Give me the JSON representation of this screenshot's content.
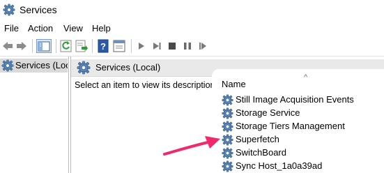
{
  "window": {
    "title": "Services",
    "icon": "services-gear-icon"
  },
  "menu": [
    "File",
    "Action",
    "View",
    "Help"
  ],
  "toolbar": {
    "buttons": [
      "back-icon",
      "forward-icon",
      "show-hide-console-tree-icon",
      "refresh-icon",
      "export-list-icon",
      "help-icon",
      "properties-icon",
      "start-service-icon",
      "stop-service-icon",
      "pause-service-icon",
      "restart-service-icon"
    ]
  },
  "tree": {
    "selected_label": "Services (Local)"
  },
  "content": {
    "header": "Services (Local)",
    "description": "Select an item to view its description.",
    "list": {
      "sort_indicator": "^",
      "column_name": "Name",
      "items": [
        "Still Image Acquisition Events",
        "Storage Service",
        "Storage Tiers Management",
        "Superfetch",
        "SwitchBoard",
        "Sync Host_1a0a39ad"
      ]
    }
  },
  "annotation": {
    "arrow_color": "#ee2a6a",
    "points_to": "Superfetch"
  },
  "colors": {
    "header_bg": "#e9e9e9",
    "tree_selected_bg": "#dadada",
    "accent_blue": "#2b6cc4"
  }
}
